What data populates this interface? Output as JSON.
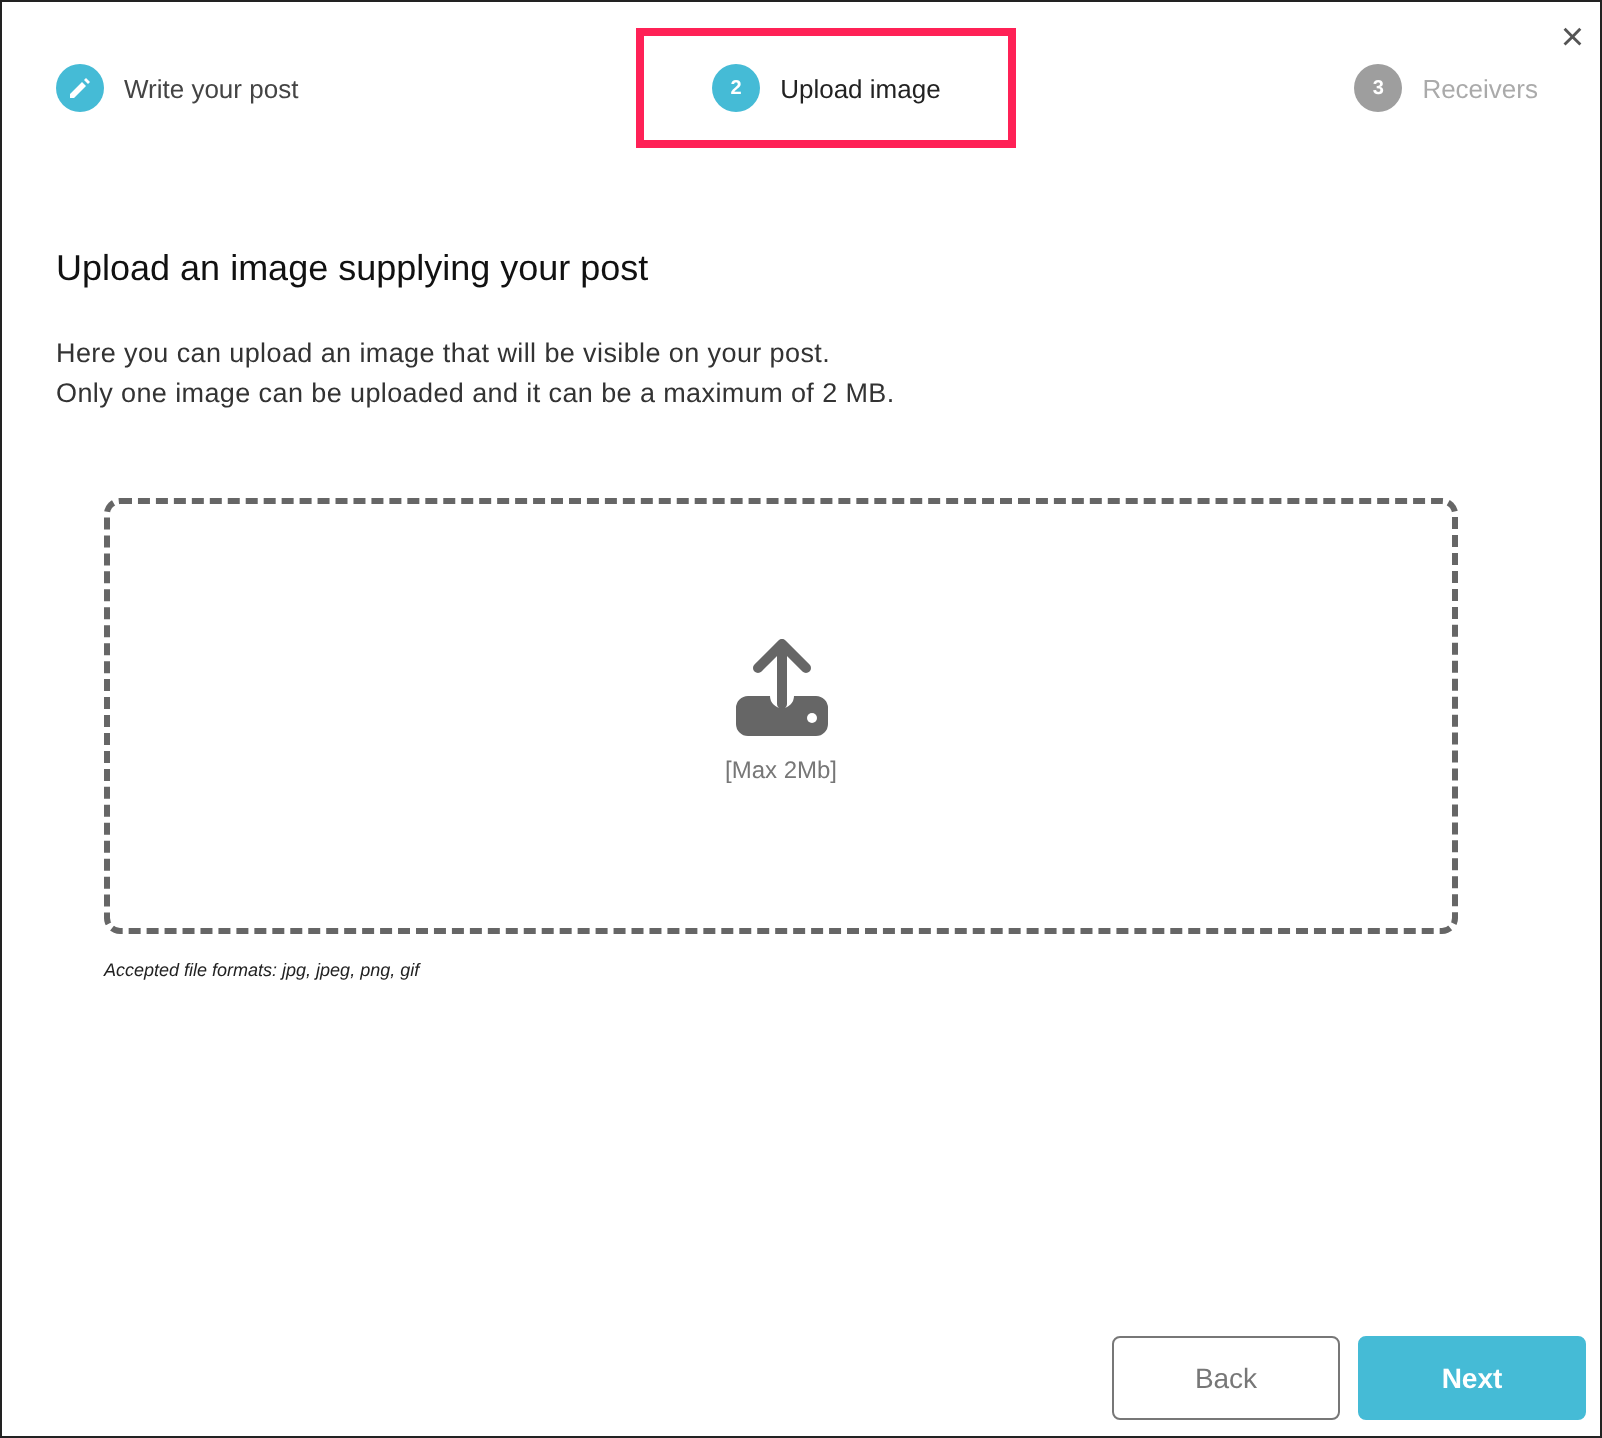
{
  "close_label": "×",
  "steps": [
    {
      "label": "Write your post",
      "completed": true,
      "disabled": false,
      "selected": false
    },
    {
      "number": "2",
      "label": "Upload image",
      "completed": false,
      "disabled": false,
      "selected": true
    },
    {
      "number": "3",
      "label": "Receivers",
      "completed": false,
      "disabled": true,
      "selected": false
    }
  ],
  "heading": "Upload an image supplying your post",
  "description": [
    "Here you can upload an image that will be visible on your post.",
    "Only one image can be uploaded and it can be a maximum of 2 MB."
  ],
  "dropzone": {
    "hint": "[Max 2Mb]"
  },
  "accepted_formats": "Accepted file formats: jpg, jpeg, png, gif",
  "buttons": [
    {
      "label": "Back",
      "kind": "secondary"
    },
    {
      "label": "Next",
      "kind": "primary"
    }
  ]
}
